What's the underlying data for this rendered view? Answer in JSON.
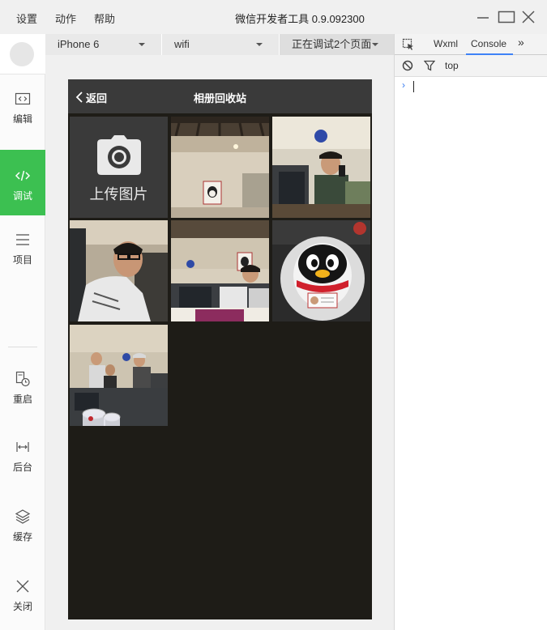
{
  "titlebar": {
    "menus": [
      "设置",
      "动作",
      "帮助"
    ],
    "title": "微信开发者工具 0.9.092300",
    "controls": [
      "minimize-icon",
      "maximize-icon",
      "close-icon"
    ]
  },
  "sidebar": {
    "items": [
      {
        "label": "编辑",
        "icon": "code-icon",
        "active": false
      },
      {
        "label": "调试",
        "icon": "debug-code-icon",
        "active": true
      },
      {
        "label": "项目",
        "icon": "list-icon",
        "active": false
      },
      {
        "label": "重启",
        "icon": "restart-icon",
        "active": false
      },
      {
        "label": "后台",
        "icon": "background-icon",
        "active": false
      },
      {
        "label": "缓存",
        "icon": "layers-icon",
        "active": false
      },
      {
        "label": "关闭",
        "icon": "close-icon",
        "active": false
      }
    ],
    "accent": "#3cc051"
  },
  "simulator": {
    "device": "iPhone 6",
    "network": "wifi",
    "debug_pages": "正在调试2个页面"
  },
  "phone": {
    "nav_back": "返回",
    "nav_title": "相册回收站",
    "upload_label": "上传图片",
    "photos": [
      "photo-office-ceiling",
      "photo-man-on-phone",
      "photo-man-selfie",
      "photo-office-desks",
      "photo-penguin-toy",
      "photo-group-office"
    ]
  },
  "devtools": {
    "tabs": [
      "Wxml",
      "Console"
    ],
    "active_tab": "Console",
    "more": "»",
    "context": "top",
    "prompt": "›"
  }
}
